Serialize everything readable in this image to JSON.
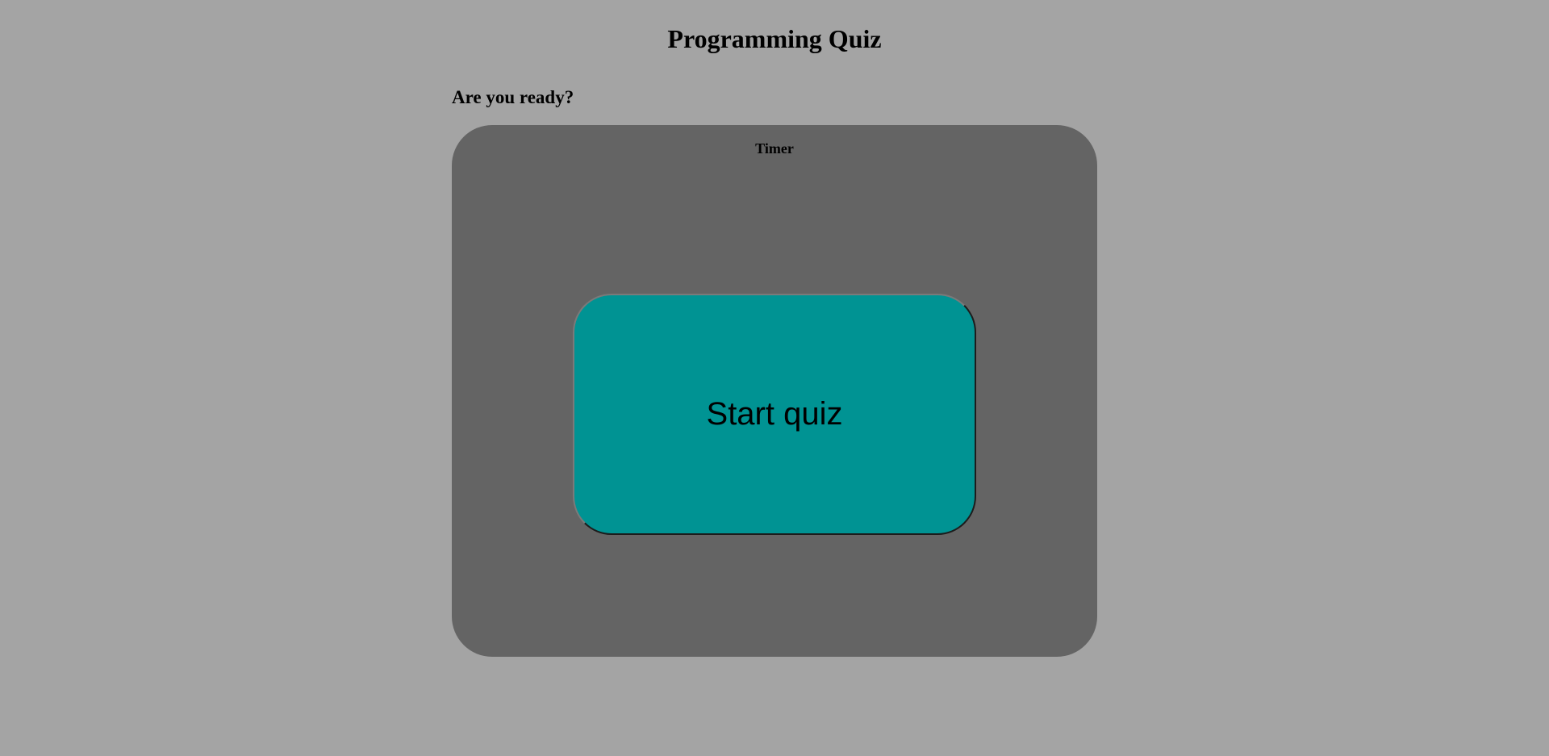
{
  "header": {
    "title": "Programming Quiz",
    "subtitle": "Are you ready?"
  },
  "quiz": {
    "timer_label": "Timer",
    "start_label": "Start quiz"
  },
  "colors": {
    "background": "#a4a4a4",
    "panel": "#646464",
    "start_button": "#009393"
  }
}
